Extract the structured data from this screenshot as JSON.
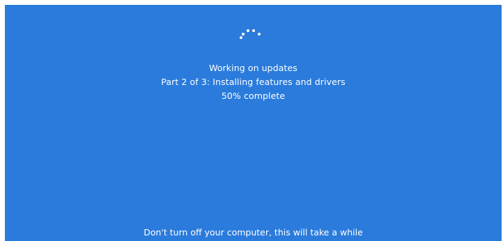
{
  "status": {
    "title": "Working on updates",
    "part": "Part 2 of 3: Installing features and drivers",
    "progress_text": "50% complete",
    "progress_percent": 50
  },
  "footer": {
    "warning": "Don't turn off your computer, this will take a while"
  },
  "icons": {
    "spinner": "loading-spinner-icon"
  },
  "colors": {
    "background": "#2a7bdc",
    "text": "#ffffff"
  }
}
